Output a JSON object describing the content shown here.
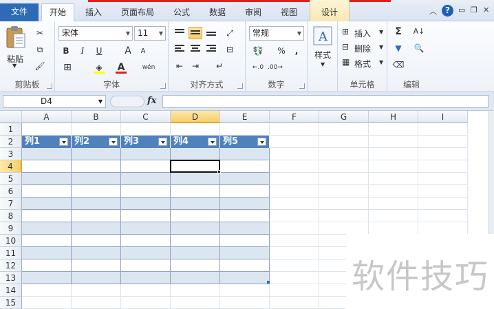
{
  "tabs": {
    "file": "文件",
    "home": "开始",
    "insert": "插入",
    "page_layout": "页面布局",
    "formulas": "公式",
    "data": "数据",
    "review": "审阅",
    "view": "视图",
    "design": "设计"
  },
  "ribbon": {
    "clipboard": {
      "label": "剪贴板",
      "paste": "粘贴"
    },
    "font": {
      "label": "字体",
      "name": "宋体",
      "size": "11",
      "bold": "B",
      "italic": "I",
      "underline": "U",
      "grow": "A",
      "shrink": "A",
      "font_color": "A",
      "phonetic": "wén"
    },
    "alignment": {
      "label": "对齐方式"
    },
    "number": {
      "label": "数字",
      "format": "常规",
      "percent": "%",
      "comma": ","
    },
    "styles": {
      "label": "样式"
    },
    "cells": {
      "label": "单元格",
      "insert": "插入",
      "delete": "删除",
      "format": "格式"
    },
    "editing": {
      "label": "编辑",
      "sum": "Σ"
    }
  },
  "formula_bar": {
    "name_box": "D4",
    "fx": "fx",
    "value": ""
  },
  "grid": {
    "columns": [
      "A",
      "B",
      "C",
      "D",
      "E",
      "F",
      "G",
      "H",
      "I"
    ],
    "rows": [
      "1",
      "2",
      "3",
      "4",
      "5",
      "6",
      "7",
      "8",
      "9",
      "10",
      "11",
      "12",
      "13",
      "14",
      "15"
    ],
    "selected_column": "D",
    "selected_row": "4",
    "active_cell": "D4",
    "table_headers": [
      "列1",
      "列2",
      "列3",
      "列4",
      "列5"
    ],
    "table_header_color": "#4f81bd",
    "table_band_color": "#dce6f1"
  },
  "watermark": "软件技巧"
}
